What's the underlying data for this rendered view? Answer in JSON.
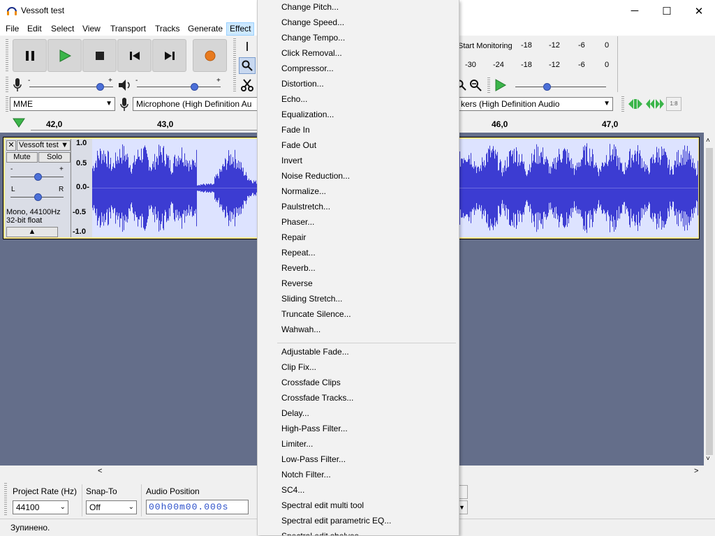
{
  "window": {
    "title": "Vessoft test",
    "controls": [
      "minimize-icon",
      "maximize-icon",
      "close-icon"
    ]
  },
  "menubar": [
    "File",
    "Edit",
    "Select",
    "View",
    "Transport",
    "Tracks",
    "Generate",
    "Effect"
  ],
  "meters": {
    "record_label": "Start Monitoring",
    "record_ticks": [
      "-18",
      "-12",
      "-6",
      "0"
    ],
    "play_ticks": [
      "-30",
      "-24",
      "-18",
      "-12",
      "-6",
      "0"
    ]
  },
  "device": {
    "host": "MME",
    "input": "Microphone (High Definition Au",
    "output": "kers (High Definition Audio"
  },
  "ruler": [
    "42,0",
    "43,0",
    "46,0",
    "47,0"
  ],
  "track": {
    "name": "Vessoft test",
    "mute": "Mute",
    "solo": "Solo",
    "gain_minus": "-",
    "gain_plus": "+",
    "pan_left": "L",
    "pan_right": "R",
    "info1": "Mono, 44100Hz",
    "info2": "32-bit float",
    "scale": [
      "1.0",
      "0.5",
      "0.0-",
      "-0.5",
      "-1.0"
    ]
  },
  "selection_bar": {
    "rate_label": "Project Rate (Hz)",
    "rate_value": "44100",
    "snap_label": "Snap-To",
    "snap_value": "Off",
    "pos_label": "Audio Position",
    "pos_value": "00h00m00.000s"
  },
  "status": "Зупинено.",
  "effect_menu": {
    "group1": [
      "Change Pitch...",
      "Change Speed...",
      "Change Tempo...",
      "Click Removal...",
      "Compressor...",
      "Distortion...",
      "Echo...",
      "Equalization...",
      "Fade In",
      "Fade Out",
      "Invert",
      "Noise Reduction...",
      "Normalize...",
      "Paulstretch...",
      "Phaser...",
      "Repair",
      "Repeat...",
      "Reverb...",
      "Reverse",
      "Sliding Stretch...",
      "Truncate Silence...",
      "Wahwah..."
    ],
    "group2": [
      "Adjustable Fade...",
      "Clip Fix...",
      "Crossfade Clips",
      "Crossfade Tracks...",
      "Delay...",
      "High-Pass Filter...",
      "Limiter...",
      "Low-Pass Filter...",
      "Notch Filter...",
      "SC4...",
      "Spectral edit multi tool",
      "Spectral edit parametric EQ...",
      "Spectral edit shelves"
    ]
  },
  "colors": {
    "accent": "#4b6fd8",
    "waveform": "#3c3cd2",
    "wave_bg": "#dde3ff",
    "track_bg": "#646e8a",
    "selected_frame": "#ffeb8c"
  }
}
